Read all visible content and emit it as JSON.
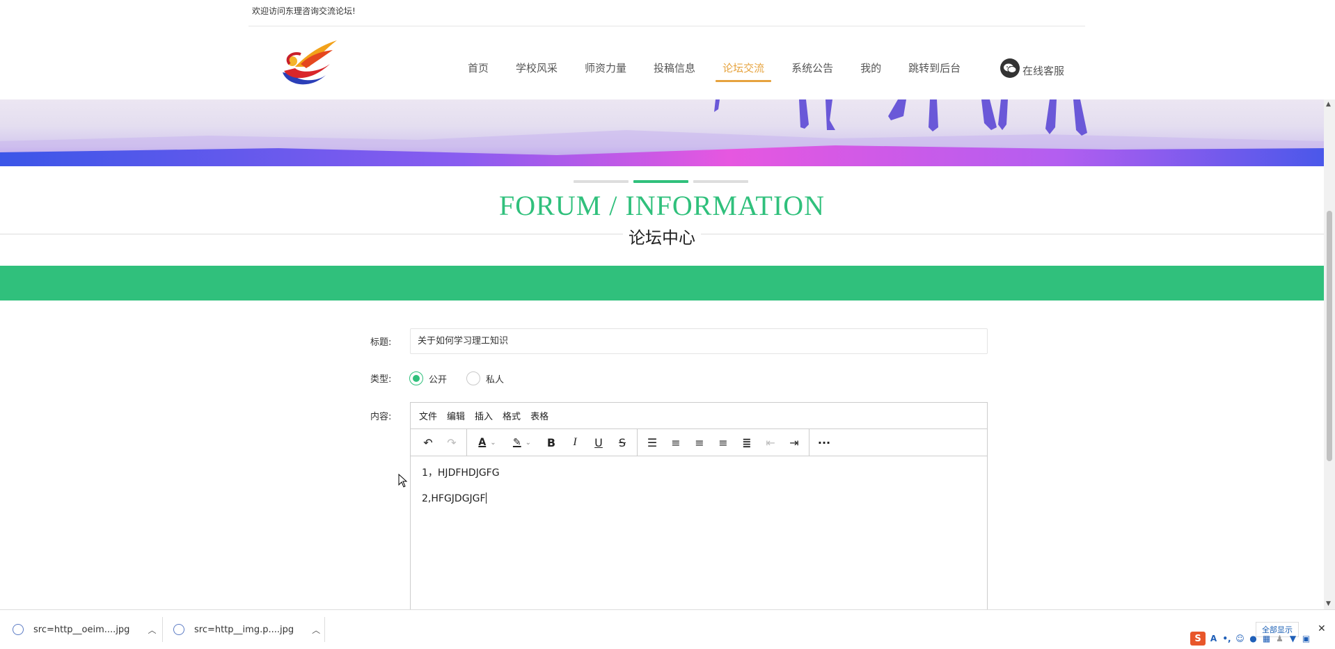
{
  "topbar": {
    "welcome": "欢迎访问东理咨询交流论坛!"
  },
  "nav": {
    "items": [
      "首页",
      "学校风采",
      "师资力量",
      "投稿信息",
      "论坛交流",
      "系统公告",
      "我的",
      "跳转到后台"
    ],
    "active_index": 4,
    "service": "在线客服"
  },
  "section": {
    "title_en": "FORUM / INFORMATION",
    "title_cn": "论坛中心"
  },
  "form": {
    "title_label": "标题:",
    "title_value": "关于如何学习理工知识",
    "type_label": "类型:",
    "type_options": [
      "公开",
      "私人"
    ],
    "type_selected": "公开",
    "content_label": "内容:"
  },
  "editor": {
    "menus": [
      "文件",
      "编辑",
      "插入",
      "格式",
      "表格"
    ],
    "tool_icons": [
      "undo-icon",
      "redo-icon",
      "font-color-icon",
      "highlight-icon",
      "bold-icon",
      "italic-icon",
      "underline-icon",
      "strikethrough-icon",
      "line-height-icon",
      "align-left-icon",
      "align-center-icon",
      "align-right-icon",
      "align-justify-icon",
      "outdent-icon",
      "indent-icon",
      "more-icon"
    ],
    "lines": [
      "1，HJDFHDJGFG",
      "2,HFGJDGJGF"
    ]
  },
  "downloads": {
    "items": [
      "src=http__oeim....jpg",
      "src=http__img.p....jpg"
    ],
    "show_all": "全部显示"
  },
  "colors": {
    "accent": "#30c07c",
    "nav_active": "#e6a33e"
  }
}
